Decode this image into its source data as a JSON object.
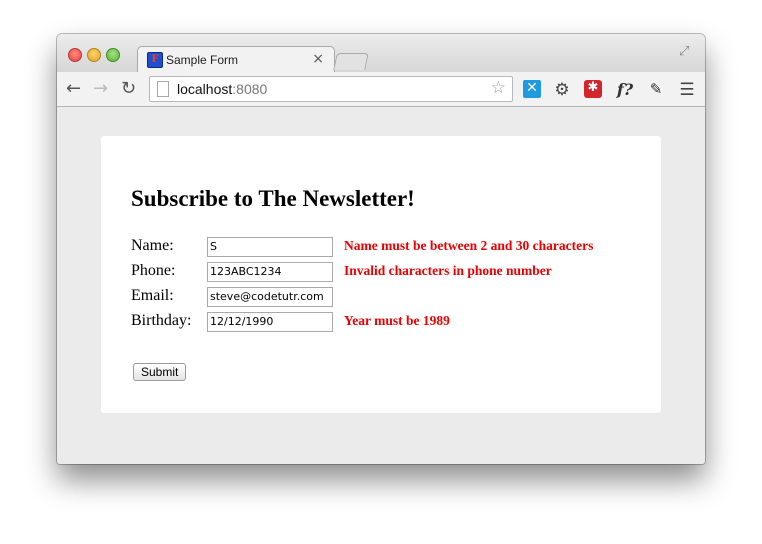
{
  "browser": {
    "tab_title": "Sample Form",
    "tab_close": "×",
    "url_host": "localhost",
    "url_port": ":8080",
    "icons": [
      "back-arrow-icon",
      "forward-arrow-icon",
      "reload-icon",
      "page-icon",
      "star-icon",
      "extension-x-icon",
      "gear-icon",
      "lastpass-icon",
      "font-finder-icon",
      "eyedropper-icon",
      "menu-icon",
      "fullscreen-icon"
    ]
  },
  "form": {
    "heading": "Subscribe to The Newsletter!",
    "fields": [
      {
        "label": "Name:",
        "value": "S",
        "error": "Name must be between 2 and 30 characters"
      },
      {
        "label": "Phone:",
        "value": "123ABC1234",
        "error": "Invalid characters in phone number"
      },
      {
        "label": "Email:",
        "value": "steve@codetutr.com",
        "error": ""
      },
      {
        "label": "Birthday:",
        "value": "12/12/1990",
        "error": "Year must be 1989"
      }
    ],
    "submit_label": "Submit"
  },
  "colors": {
    "error": "#ee0000",
    "viewport_bg": "#ebebeb",
    "card_bg": "#ffffff"
  }
}
